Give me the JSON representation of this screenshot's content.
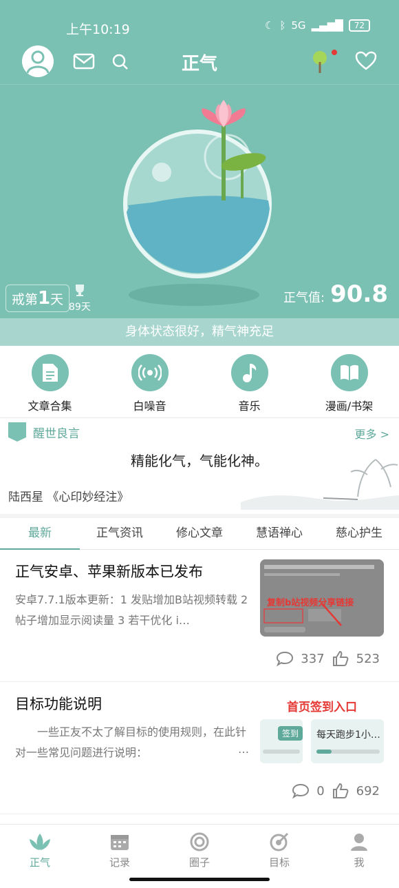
{
  "status_bar": {
    "time": "上午10:19",
    "network": "5G",
    "battery": "72"
  },
  "header": {
    "title": "正气"
  },
  "hero": {
    "day_prefix": "戒第",
    "day_num": "1",
    "day_suffix": "天",
    "best_days": "89天",
    "value_label": "正气值:",
    "value": "90.8",
    "status_text": "身体状态很好，精气神充足"
  },
  "quick_links": [
    {
      "label": "文章合集",
      "icon": "document-icon"
    },
    {
      "label": "白噪音",
      "icon": "radio-waves-icon"
    },
    {
      "label": "音乐",
      "icon": "music-note-icon"
    },
    {
      "label": "漫画/书架",
      "icon": "book-icon"
    }
  ],
  "quote": {
    "section_title": "醒世良言",
    "more": "更多 >",
    "text": "精能化气，气能化神。",
    "author": "陆西星 《心印妙经注》"
  },
  "tabs": [
    "最新",
    "正气资讯",
    "修心文章",
    "慧语禅心",
    "慈心护生"
  ],
  "articles": [
    {
      "title": "正气安卓、苹果新版本已发布",
      "summary": "安卓7.7.1版本更新：1 发贴增加B站视频转载 2 帖子增加显示阅读量 3 若干优化 i…",
      "comments": "337",
      "likes": "523",
      "thumb_overlay": "复制b站视频分享链接"
    },
    {
      "title": "目标功能说明",
      "summary": "一些正友不太了解目标的使用规则，在此针对一些常见问题进行说明：",
      "ellipsis": "…",
      "comments": "0",
      "likes": "692",
      "thumb_heading": "首页签到入口",
      "thumb_chip": "签到",
      "thumb_card": "每天跑步1小…"
    }
  ],
  "bottom_nav": [
    {
      "label": "正气",
      "icon": "lotus-icon"
    },
    {
      "label": "记录",
      "icon": "calendar-icon"
    },
    {
      "label": "圈子",
      "icon": "circle-icon"
    },
    {
      "label": "目标",
      "icon": "target-icon"
    },
    {
      "label": "我",
      "icon": "person-icon"
    }
  ],
  "colors": {
    "accent": "#7ac0b3",
    "accent_text": "#5fa99b",
    "water": "#5fb3c4",
    "lotus": "#f07b92",
    "leaf": "#7ab342"
  }
}
